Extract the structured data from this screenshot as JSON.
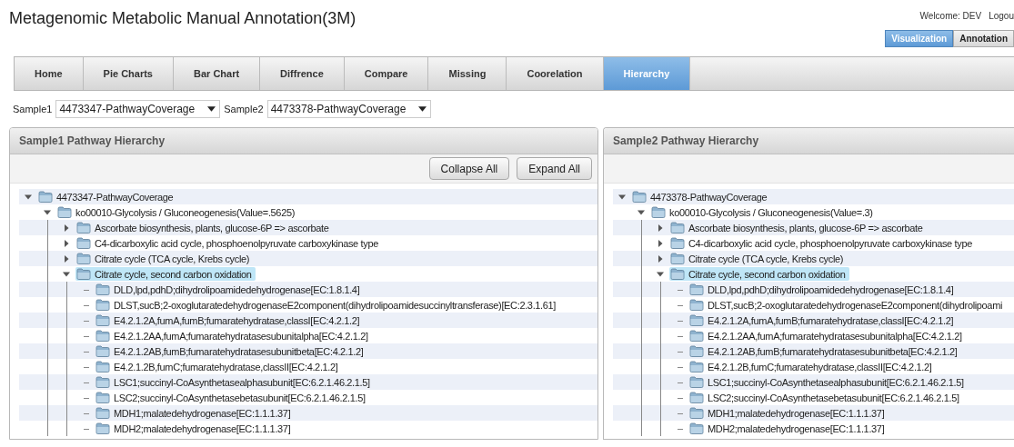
{
  "app_title": "Metagenomic Metabolic Manual Annotation(3M)",
  "welcome": "Welcome: DEV",
  "logout": "Logou",
  "modes": [
    {
      "label": "Visualization",
      "selected": true
    },
    {
      "label": "Annotation",
      "selected": false
    }
  ],
  "tabs": [
    {
      "label": "Home",
      "selected": false
    },
    {
      "label": "Pie Charts",
      "selected": false
    },
    {
      "label": "Bar Chart",
      "selected": false
    },
    {
      "label": "Diffrence",
      "selected": false
    },
    {
      "label": "Compare",
      "selected": false
    },
    {
      "label": "Missing",
      "selected": false
    },
    {
      "label": "Coorelation",
      "selected": false
    },
    {
      "label": "Hierarchy",
      "selected": true
    }
  ],
  "samples": [
    {
      "label": "Sample1",
      "value": "4473347-PathwayCoverage"
    },
    {
      "label": "Sample2",
      "value": "4473378-PathwayCoverage"
    }
  ],
  "panels": [
    {
      "title": "Sample1 Pathway Hierarchy",
      "buttons": [
        "Collapse All",
        "Expand All"
      ],
      "tree": [
        {
          "label": "4473347-PathwayCoverage",
          "expanded": true,
          "selected": false,
          "children": [
            {
              "label": "ko00010-Glycolysis / Gluconeogenesis(Value=.5625)",
              "expanded": true,
              "selected": false,
              "children": [
                {
                  "label": "Ascorbate biosynthesis, plants, glucose-6P => ascorbate",
                  "expanded": false,
                  "selected": false
                },
                {
                  "label": "C4-dicarboxylic acid cycle, phosphoenolpyruvate carboxykinase type",
                  "expanded": false,
                  "selected": false
                },
                {
                  "label": "Citrate cycle (TCA cycle, Krebs cycle)",
                  "expanded": false,
                  "selected": false
                },
                {
                  "label": "Citrate cycle, second carbon oxidation",
                  "expanded": true,
                  "selected": true,
                  "children": [
                    {
                      "label": "DLD,lpd,pdhD;dihydrolipoamidedehydrogenase[EC:1.8.1.4]",
                      "selected": false
                    },
                    {
                      "label": "DLST,sucB;2-oxoglutaratedehydrogenaseE2component(dihydrolipoamidesuccinyltransferase)[EC:2.3.1.61]",
                      "selected": false
                    },
                    {
                      "label": "E4.2.1.2A,fumA,fumB;fumaratehydratase,classI[EC:4.2.1.2]",
                      "selected": false
                    },
                    {
                      "label": "E4.2.1.2AA,fumA;fumaratehydratasesubunitalpha[EC:4.2.1.2]",
                      "selected": false
                    },
                    {
                      "label": "E4.2.1.2AB,fumB;fumaratehydratasesubunitbeta[EC:4.2.1.2]",
                      "selected": false
                    },
                    {
                      "label": "E4.2.1.2B,fumC;fumaratehydratase,classII[EC:4.2.1.2]",
                      "selected": false
                    },
                    {
                      "label": "LSC1;succinyl-CoAsynthetasealphasubunit[EC:6.2.1.46.2.1.5]",
                      "selected": false
                    },
                    {
                      "label": "LSC2;succinyl-CoAsynthetasebetasubunit[EC:6.2.1.46.2.1.5]",
                      "selected": false
                    },
                    {
                      "label": "MDH1;malatedehydrogenase[EC:1.1.1.37]",
                      "selected": false
                    },
                    {
                      "label": "MDH2;malatedehydrogenase[EC:1.1.1.37]",
                      "selected": false
                    }
                  ]
                }
              ]
            }
          ]
        }
      ]
    },
    {
      "title": "Sample2 Pathway Hierarchy",
      "tree": [
        {
          "label": "4473378-PathwayCoverage",
          "expanded": true,
          "selected": false,
          "children": [
            {
              "label": "ko00010-Glycolysis / Gluconeogenesis(Value=.3)",
              "expanded": true,
              "selected": false,
              "children": [
                {
                  "label": "Ascorbate biosynthesis, plants, glucose-6P => ascorbate",
                  "expanded": false,
                  "selected": false
                },
                {
                  "label": "C4-dicarboxylic acid cycle, phosphoenolpyruvate carboxykinase type",
                  "expanded": false,
                  "selected": false
                },
                {
                  "label": "Citrate cycle (TCA cycle, Krebs cycle)",
                  "expanded": false,
                  "selected": false
                },
                {
                  "label": "Citrate cycle, second carbon oxidation",
                  "expanded": true,
                  "selected": true,
                  "children": [
                    {
                      "label": "DLD,lpd,pdhD;dihydrolipoamidedehydrogenase[EC:1.8.1.4]",
                      "selected": false
                    },
                    {
                      "label": "DLST,sucB;2-oxoglutaratedehydrogenaseE2component(dihydrolipoami",
                      "selected": false
                    },
                    {
                      "label": "E4.2.1.2A,fumA,fumB;fumaratehydratase,classI[EC:4.2.1.2]",
                      "selected": false
                    },
                    {
                      "label": "E4.2.1.2AA,fumA;fumaratehydratasesubunitalpha[EC:4.2.1.2]",
                      "selected": false
                    },
                    {
                      "label": "E4.2.1.2AB,fumB;fumaratehydratasesubunitbeta[EC:4.2.1.2]",
                      "selected": false
                    },
                    {
                      "label": "E4.2.1.2B,fumC;fumaratehydratase,classII[EC:4.2.1.2]",
                      "selected": false
                    },
                    {
                      "label": "LSC1;succinyl-CoAsynthetasealphasubunit[EC:6.2.1.46.2.1.5]",
                      "selected": false
                    },
                    {
                      "label": "LSC2;succinyl-CoAsynthetasebetasubunit[EC:6.2.1.46.2.1.5]",
                      "selected": false
                    },
                    {
                      "label": "MDH1;malatedehydrogenase[EC:1.1.1.37]",
                      "selected": false
                    },
                    {
                      "label": "MDH2;malatedehydrogenase[EC:1.1.1.37]",
                      "selected": false
                    }
                  ]
                }
              ]
            }
          ]
        }
      ]
    }
  ]
}
